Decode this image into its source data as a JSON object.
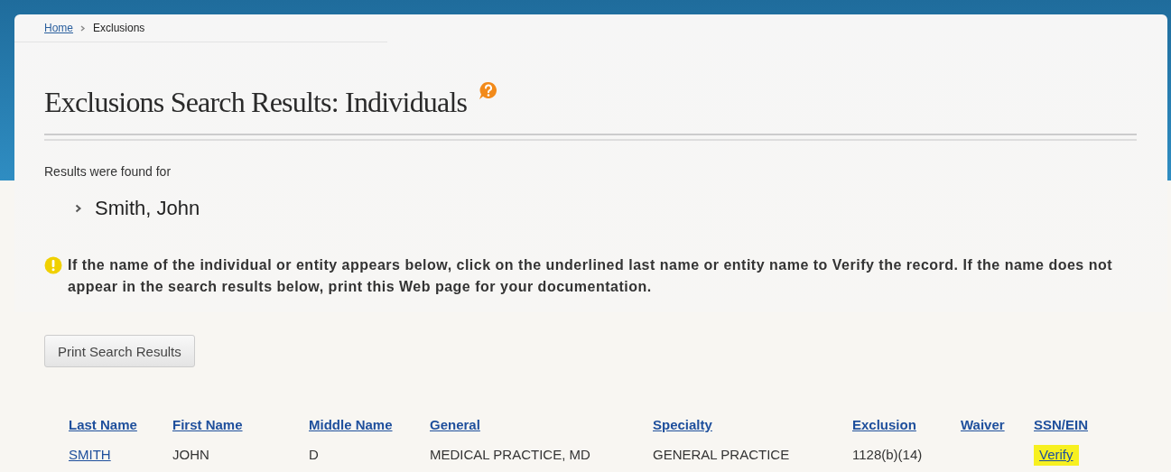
{
  "breadcrumb": [
    {
      "label": "Home",
      "kind": "link"
    },
    {
      "label": "Exclusions",
      "kind": "current"
    }
  ],
  "title": "Exclusions Search Results: Individuals",
  "results_intro": "Results were found for",
  "search_names": [
    "Smith, John"
  ],
  "notice": "If the name of the individual or entity appears below, click on the underlined last name or entity name to Verify the record. If the name does not appear in the search results below, print this Web page for your documentation.",
  "print_button": "Print Search Results",
  "table": {
    "columns": [
      "Last Name",
      "First Name",
      "Middle Name",
      "General",
      "Specialty",
      "Exclusion",
      "Waiver",
      "SSN/EIN"
    ],
    "rows": [
      {
        "last_name": "SMITH",
        "first_name": "JOHN",
        "middle_name": "D",
        "general": "MEDICAL PRACTICE, MD",
        "specialty": "GENERAL PRACTICE",
        "exclusion": "1128(b)(14)",
        "ssn_ein": {
          "text": "Verify",
          "highlighted": true
        }
      }
    ]
  }
}
